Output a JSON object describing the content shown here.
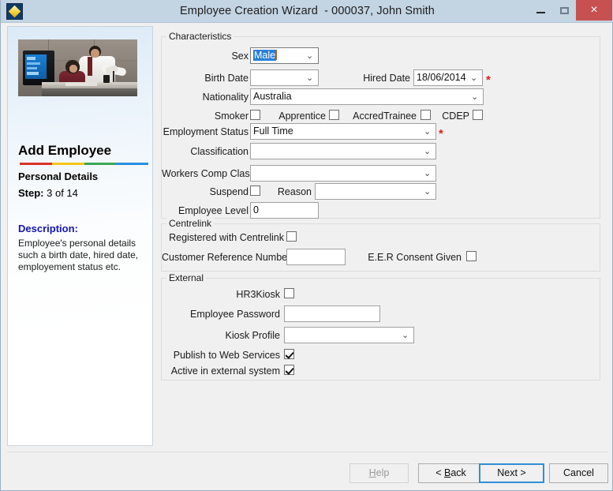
{
  "window": {
    "title": "Employee Creation Wizard  - 000037, John Smith",
    "app_icon": "diamond-logo-icon",
    "minimize_label": "",
    "maximize_label": "",
    "close_label": "×",
    "titlebar_color": "#c3d4e3",
    "close_button_color": "#c75050"
  },
  "sidebar": {
    "photo_alt": "office-workers-photo",
    "title": "Add Employee",
    "color_bar": [
      "#d9342b",
      "#f5c518",
      "#3aa757",
      "#2a8fe0"
    ],
    "subtitle": "Personal Details",
    "step_label": "Step:",
    "step_value": "3 of 14",
    "description_heading": "Description:",
    "description_heading_color": "#1414b4",
    "description_body": "Employee's personal details such a birth date, hired date, employement status etc."
  },
  "groups": {
    "characteristics": {
      "legend": "Characteristics",
      "fields": {
        "sex": {
          "label": "Sex",
          "value": "Male",
          "selected": true,
          "required": false
        },
        "birth_date": {
          "label": "Birth Date",
          "value": "",
          "required": false
        },
        "hired_date": {
          "label": "Hired Date",
          "value": "18/06/2014",
          "required": true
        },
        "nationality": {
          "label": "Nationality",
          "value": "Australia",
          "required": false
        },
        "smoker": {
          "label": "Smoker",
          "checked": false
        },
        "apprentice": {
          "label": "Apprentice",
          "checked": false
        },
        "accred_trainee": {
          "label": "AccredTrainee",
          "checked": false
        },
        "cdep": {
          "label": "CDEP",
          "checked": false
        },
        "employment_status": {
          "label": "Employment Status",
          "value": "Full Time",
          "required": true
        },
        "classification": {
          "label": "Classification",
          "value": "",
          "required": false
        },
        "workers_comp_class": {
          "label": "Workers Comp Class",
          "value": "",
          "required": false
        },
        "suspend": {
          "label": "Suspend",
          "checked": false
        },
        "reason": {
          "label": "Reason",
          "value": "",
          "required": false
        },
        "employee_level": {
          "label": "Employee Level",
          "value": "0",
          "required": false
        }
      }
    },
    "centrelink": {
      "legend": "Centrelink",
      "fields": {
        "registered": {
          "label": "Registered with Centrelink",
          "checked": false
        },
        "customer_reference_number": {
          "label": "Customer Reference Number",
          "value": ""
        },
        "eer_consent": {
          "label": "E.E.R Consent Given",
          "checked": false
        }
      }
    },
    "external": {
      "legend": "External",
      "fields": {
        "hr3kiosk": {
          "label": "HR3Kiosk",
          "checked": false
        },
        "employee_password": {
          "label": "Employee Password",
          "value": ""
        },
        "kiosk_profile": {
          "label": "Kiosk Profile",
          "value": ""
        },
        "publish_web_services": {
          "label": "Publish to Web Services",
          "checked": true
        },
        "active_external": {
          "label": "Active in external system",
          "checked": true
        }
      }
    }
  },
  "buttons": {
    "help": "Help",
    "help_disabled": true,
    "back": "< Back",
    "next": "Next >",
    "cancel": "Cancel"
  },
  "icons": {
    "dropdown_arrow": "⌄"
  }
}
